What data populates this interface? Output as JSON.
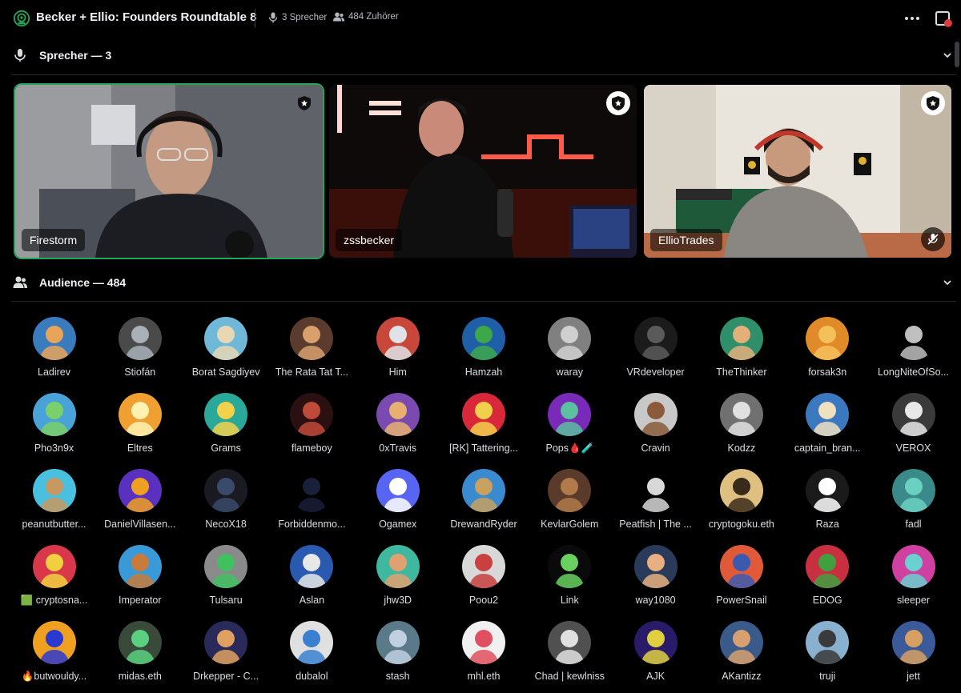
{
  "header": {
    "title": "Becker + Ellio: Founders Roundtable 8",
    "speakers_count": "3 Sprecher",
    "listeners_count": "484 Zuhörer"
  },
  "speakers_section": {
    "label": "Sprecher — 3"
  },
  "speakers": [
    {
      "name": "Firestorm",
      "speaking": true,
      "moderator": true,
      "muted": false
    },
    {
      "name": "zssbecker",
      "speaking": false,
      "moderator": true,
      "muted": false
    },
    {
      "name": "EllioTrades",
      "speaking": false,
      "moderator": true,
      "muted": true
    }
  ],
  "audience_section": {
    "label": "Audience — 484"
  },
  "audience": [
    {
      "name": "Ladirev",
      "color": "#3a7bbd",
      "color2": "#e9a45a"
    },
    {
      "name": "Stiofán",
      "color": "#4a4a4a",
      "color2": "#a8b0b8"
    },
    {
      "name": "Borat Sagdiyev",
      "color": "#6fb8d8",
      "color2": "#e8d7b5"
    },
    {
      "name": "The Rata Tat T...",
      "color": "#5a3b2e",
      "color2": "#d9a06e"
    },
    {
      "name": "Him",
      "color": "#c8473a",
      "color2": "#dfe3e8"
    },
    {
      "name": "Hamzah",
      "color": "#1f5fa8",
      "color2": "#3da84a"
    },
    {
      "name": "waray",
      "color": "#808080",
      "color2": "#d0d0d0"
    },
    {
      "name": "VRdeveloper",
      "color": "#1b1b1b",
      "color2": "#5a5a5a"
    },
    {
      "name": "TheThinker",
      "color": "#2f8f6a",
      "color2": "#e3b07a"
    },
    {
      "name": "forsak3n",
      "color": "#e08a2a",
      "color2": "#f5c05a"
    },
    {
      "name": "LongNiteOfSo...",
      "color": "#000000",
      "color2": "#bfbfbf"
    },
    {
      "name": "Pho3n9x",
      "color": "#4aa3d8",
      "color2": "#7ad06a"
    },
    {
      "name": "Eltres",
      "color": "#f0a030",
      "color2": "#fff2b0"
    },
    {
      "name": "Grams",
      "color": "#2aa89a",
      "color2": "#f2d24a"
    },
    {
      "name": "flameboy",
      "color": "#2a1010",
      "color2": "#c04a3a"
    },
    {
      "name": "0xTravis",
      "color": "#7a4ab0",
      "color2": "#e8b070"
    },
    {
      "name": "[RK] Tattering...",
      "color": "#d8283a",
      "color2": "#f2d04a"
    },
    {
      "name": "Pops🩸🧪",
      "color": "#7a2ab8",
      "color2": "#5ac0a0"
    },
    {
      "name": "Cravin",
      "color": "#c8c8c8",
      "color2": "#8a5a3a"
    },
    {
      "name": "Kodzz",
      "color": "#707070",
      "color2": "#e0e0e0"
    },
    {
      "name": "captain_bran...",
      "color": "#3a78c0",
      "color2": "#f0e0c0"
    },
    {
      "name": "VEROX",
      "color": "#3a3a3a",
      "color2": "#e8e8e8"
    },
    {
      "name": "peanutbutter...",
      "color": "#4ac0e0",
      "color2": "#c89860"
    },
    {
      "name": "DanielVillasen...",
      "color": "#5a30c0",
      "color2": "#f0a020"
    },
    {
      "name": "NecoX18",
      "color": "#1a1a22",
      "color2": "#3a4a6a"
    },
    {
      "name": "Forbiddenmo...",
      "color": "#000000",
      "color2": "#1a1f3a"
    },
    {
      "name": "Ogamex",
      "color": "#5865f2",
      "color2": "#ffffff"
    },
    {
      "name": "DrewandRyder",
      "color": "#3a8ad0",
      "color2": "#c8a060"
    },
    {
      "name": "KevlarGolem",
      "color": "#5a3a2a",
      "color2": "#b07a4a"
    },
    {
      "name": "Peatfish | The ...",
      "color": "#000000",
      "color2": "#d8d8d8"
    },
    {
      "name": "cryptogoku.eth",
      "color": "#e0c080",
      "color2": "#3a2a1a"
    },
    {
      "name": "Raza",
      "color": "#1a1a1a",
      "color2": "#ffffff"
    },
    {
      "name": "fadl",
      "color": "#3a8a8a",
      "color2": "#6ad0c0"
    },
    {
      "name": "🟩 cryptosna...",
      "color": "#d8384a",
      "color2": "#f0d040"
    },
    {
      "name": "Imperator",
      "color": "#3a9ad8",
      "color2": "#c87a3a"
    },
    {
      "name": "Tulsaru",
      "color": "#8a8a8a",
      "color2": "#40c060"
    },
    {
      "name": "Aslan",
      "color": "#2a5ab0",
      "color2": "#e8e8e8"
    },
    {
      "name": "jhw3D",
      "color": "#40b8a0",
      "color2": "#e0a070"
    },
    {
      "name": "Poou2",
      "color": "#d8d8d8",
      "color2": "#c84040"
    },
    {
      "name": "Link",
      "color": "#0a0a0a",
      "color2": "#6ad060"
    },
    {
      "name": "way1080",
      "color": "#2a3a5a",
      "color2": "#e8b080"
    },
    {
      "name": "PowerSnail",
      "color": "#e05a3a",
      "color2": "#3a5ab0"
    },
    {
      "name": "EDOG",
      "color": "#c83040",
      "color2": "#40a040"
    },
    {
      "name": "sleeper",
      "color": "#d040a0",
      "color2": "#6ad0d0"
    },
    {
      "name": "🔥butwouldy...",
      "color": "#f0a020",
      "color2": "#2a3ad0"
    },
    {
      "name": "midas.eth",
      "color": "#3a4a3a",
      "color2": "#5ad080"
    },
    {
      "name": "Drkepper - C...",
      "color": "#2a2a5a",
      "color2": "#e0a060"
    },
    {
      "name": "dubalol",
      "color": "#e0e0e0",
      "color2": "#3a80d0"
    },
    {
      "name": "stash",
      "color": "#5a7a8a",
      "color2": "#c0d0e0"
    },
    {
      "name": "mhl.eth",
      "color": "#f0f0f0",
      "color2": "#e05060"
    },
    {
      "name": "Chad | kewlniss",
      "color": "#505050",
      "color2": "#e0e0e0"
    },
    {
      "name": "AJK",
      "color": "#2a1a6a",
      "color2": "#e0d040"
    },
    {
      "name": "AKantizz",
      "color": "#3a5a8a",
      "color2": "#d8a070"
    },
    {
      "name": "truji",
      "color": "#8ab0d0",
      "color2": "#3a3a3a"
    },
    {
      "name": "jett",
      "color": "#3a5a9a",
      "color2": "#d8a060"
    }
  ]
}
